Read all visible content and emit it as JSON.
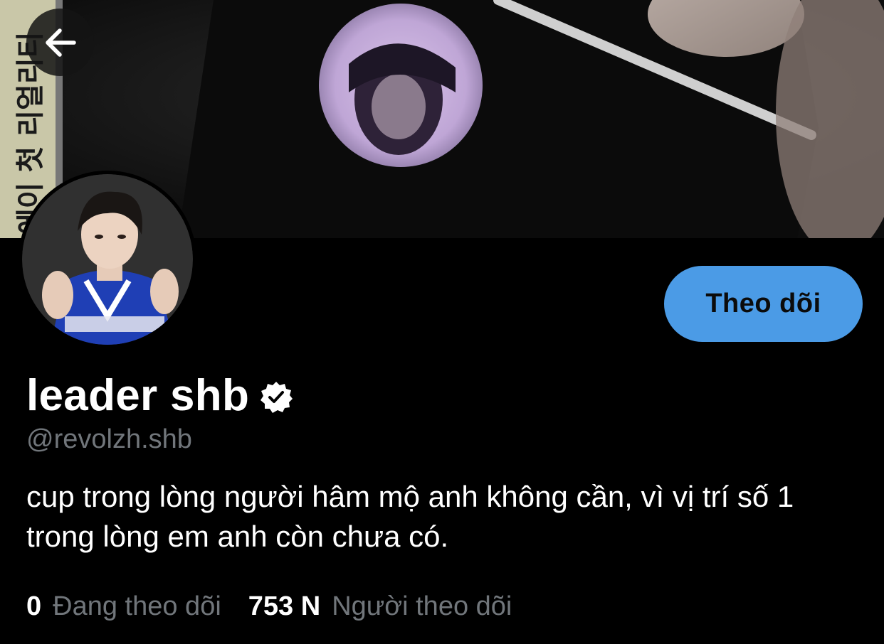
{
  "profile": {
    "display_name": "leader shb",
    "handle": "@revolzh.shb",
    "bio": "cup trong lòng người hâm mộ anh không cần, vì vị trí số 1 trong lòng em anh còn chưa có.",
    "verified": true
  },
  "actions": {
    "follow_label": "Theo dõi"
  },
  "stats": {
    "following_count": "0",
    "following_label": "Đang theo dõi",
    "followers_count": "753 N",
    "followers_label": "Người theo dõi"
  },
  "banner": {
    "side_text": "에이 첫 리얼리티"
  },
  "colors": {
    "background": "#000000",
    "accent": "#4b9be6",
    "secondary_text": "#71767b",
    "primary_text": "#ffffff"
  },
  "icons": {
    "back": "arrow-left-icon",
    "verified": "verified-badge-icon"
  }
}
